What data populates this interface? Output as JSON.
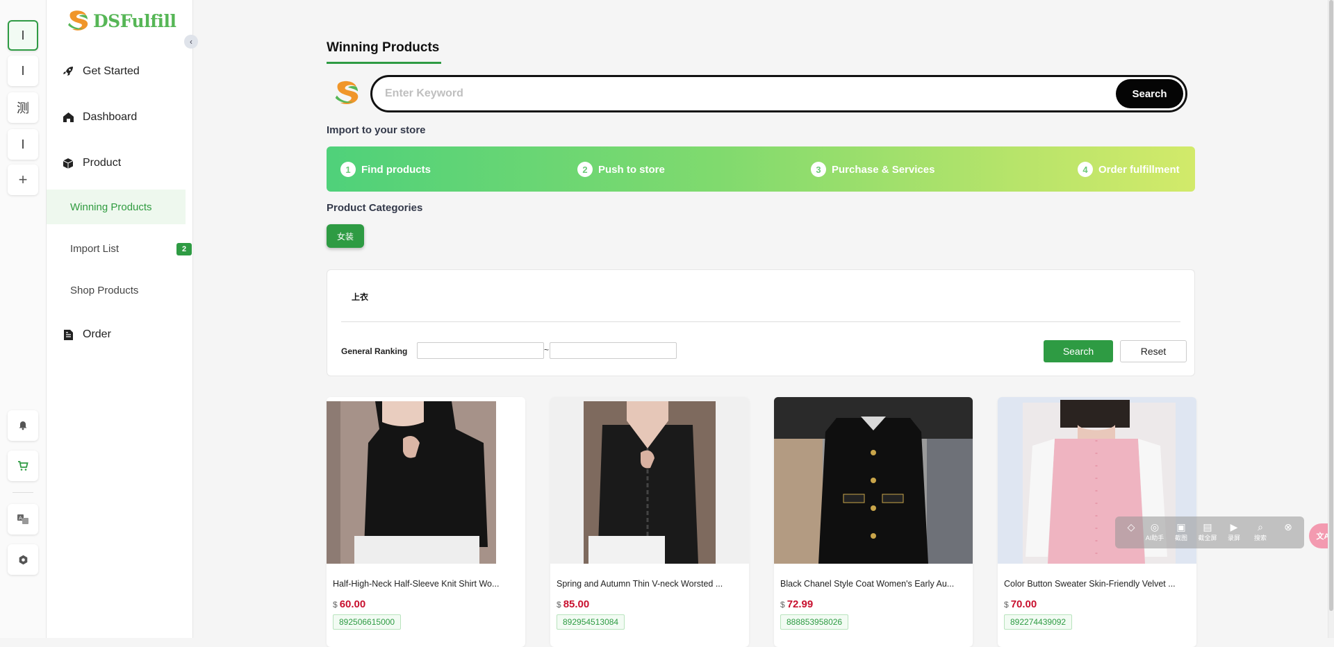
{
  "rail": {
    "items": [
      {
        "label": "I",
        "active": true
      },
      {
        "label": "I"
      },
      {
        "label": "测"
      },
      {
        "label": "I"
      },
      {
        "label": "+"
      }
    ]
  },
  "sidebar": {
    "brand": "DSFulfill",
    "nav": {
      "get_started": "Get Started",
      "dashboard": "Dashboard",
      "product": "Product",
      "winning_products": "Winning Products",
      "import_list": "Import List",
      "import_list_count": "2",
      "shop_products": "Shop Products",
      "order": "Order"
    }
  },
  "main": {
    "tab": "Winning Products",
    "search": {
      "placeholder": "Enter Keyword",
      "button": "Search"
    },
    "import_title": "Import to your store",
    "steps": [
      {
        "num": "1",
        "label": "Find products"
      },
      {
        "num": "2",
        "label": "Push to store"
      },
      {
        "num": "3",
        "label": "Purchase & Services"
      },
      {
        "num": "4",
        "label": "Order fulfillment"
      }
    ],
    "categories_title": "Product Categories",
    "category": "女装",
    "filter": {
      "subcategory": "上衣",
      "ranking_label": "General Ranking",
      "tilde": "~",
      "search_button": "Search",
      "reset_button": "Reset"
    },
    "products": [
      {
        "title": "Half-High-Neck Half-Sleeve Knit Shirt Wo...",
        "currency": "$",
        "price": "60.00",
        "sku": "892506615000"
      },
      {
        "title": "Spring and Autumn Thin V-neck Worsted ...",
        "currency": "$",
        "price": "85.00",
        "sku": "892954513084"
      },
      {
        "title": "Black Chanel Style Coat Women's Early Au...",
        "currency": "$",
        "price": "72.99",
        "sku": "888853958026"
      },
      {
        "title": "Color Button Sweater Skin-Friendly Velvet ...",
        "currency": "$",
        "price": "70.00",
        "sku": "892274439092"
      }
    ]
  },
  "overlay_toolbar": {
    "items": [
      "AI助手",
      "截图",
      "截全屏",
      "录屏",
      "搜索"
    ]
  },
  "colors": {
    "brand_green": "#2e9b43",
    "price_red": "#c8102e",
    "logo_green": "#56b656",
    "logo_orange": "#f0962a"
  }
}
